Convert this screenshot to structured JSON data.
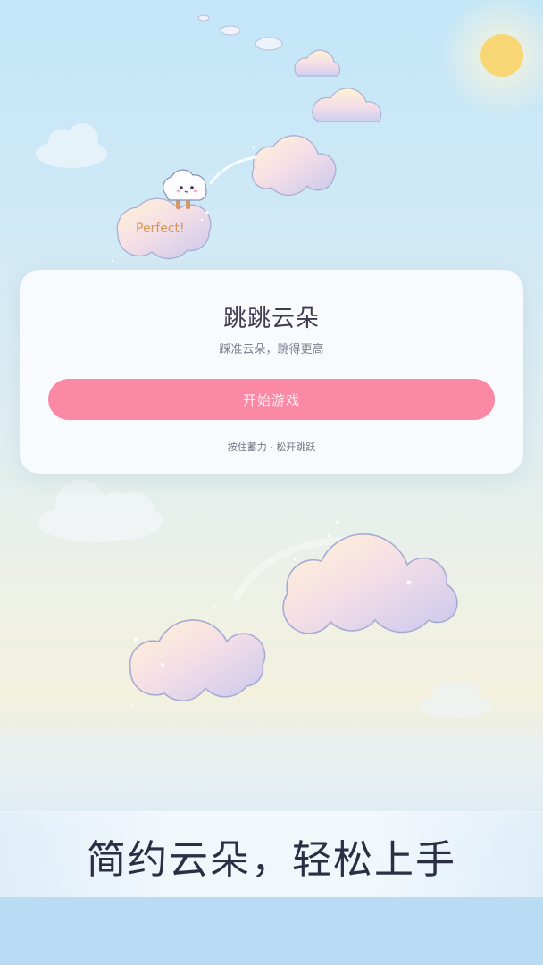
{
  "feedback": {
    "perfect_label": "Perfect!"
  },
  "card": {
    "title": "跳跳云朵",
    "subtitle": "踩准云朵，跳得更高",
    "start_button": "开始游戏",
    "hint": "按住蓄力 · 松开跳跃"
  },
  "banner": {
    "slogan": "简约云朵，轻松上手"
  },
  "colors": {
    "button": "#fb89a5",
    "sun": "#f8d674",
    "sky_top": "#c3e6f8",
    "text_dark": "#3f3d50"
  }
}
